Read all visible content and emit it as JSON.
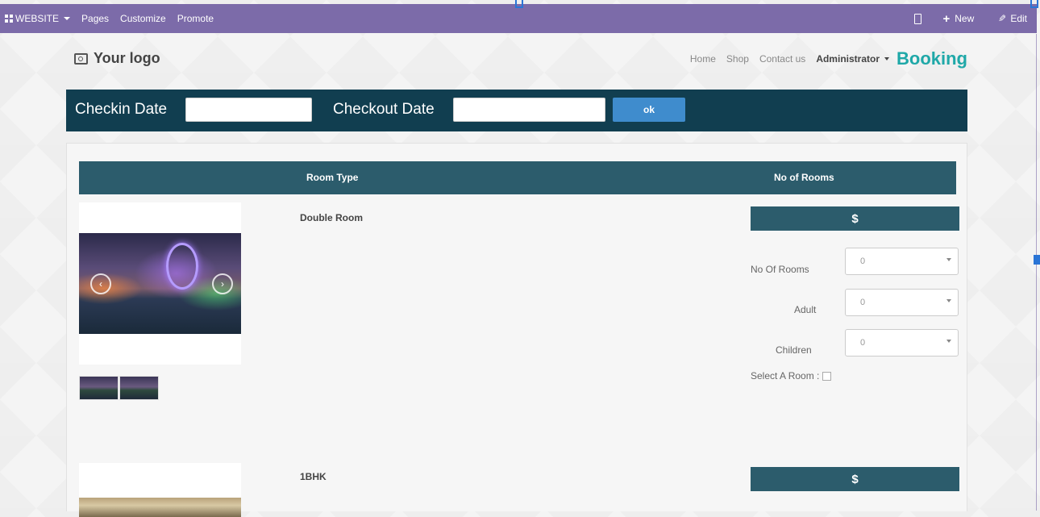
{
  "topbar": {
    "website_label": "WEBSITE",
    "menu": [
      "Pages",
      "Customize",
      "Promote"
    ],
    "new_label": "New",
    "edit_label": "Edit"
  },
  "header": {
    "logo_text": "Your logo",
    "nav": [
      "Home",
      "Shop",
      "Contact us"
    ],
    "user": "Administrator",
    "brand": "Booking"
  },
  "search": {
    "checkin_label": "Checkin Date",
    "checkin_value": "",
    "checkout_label": "Checkout Date",
    "checkout_value": "",
    "ok_label": "ok"
  },
  "table": {
    "col_room_type": "Room Type",
    "col_rooms": "No of Rooms"
  },
  "rooms": [
    {
      "name": "Double Room",
      "price": "$",
      "no_of_rooms_label": "No Of Rooms",
      "no_of_rooms_value": "0",
      "adult_label": "Adult",
      "adult_value": "0",
      "children_label": "Children",
      "children_value": "0",
      "select_label": "Select A Room :"
    },
    {
      "name": "1BHK",
      "price": "$"
    }
  ],
  "colors": {
    "admin_bar": "#7c6ba9",
    "date_bar": "#113e50",
    "table_header": "#2c5c6c",
    "ok_button": "#3f8ccd",
    "brand": "#1fa8a8"
  }
}
